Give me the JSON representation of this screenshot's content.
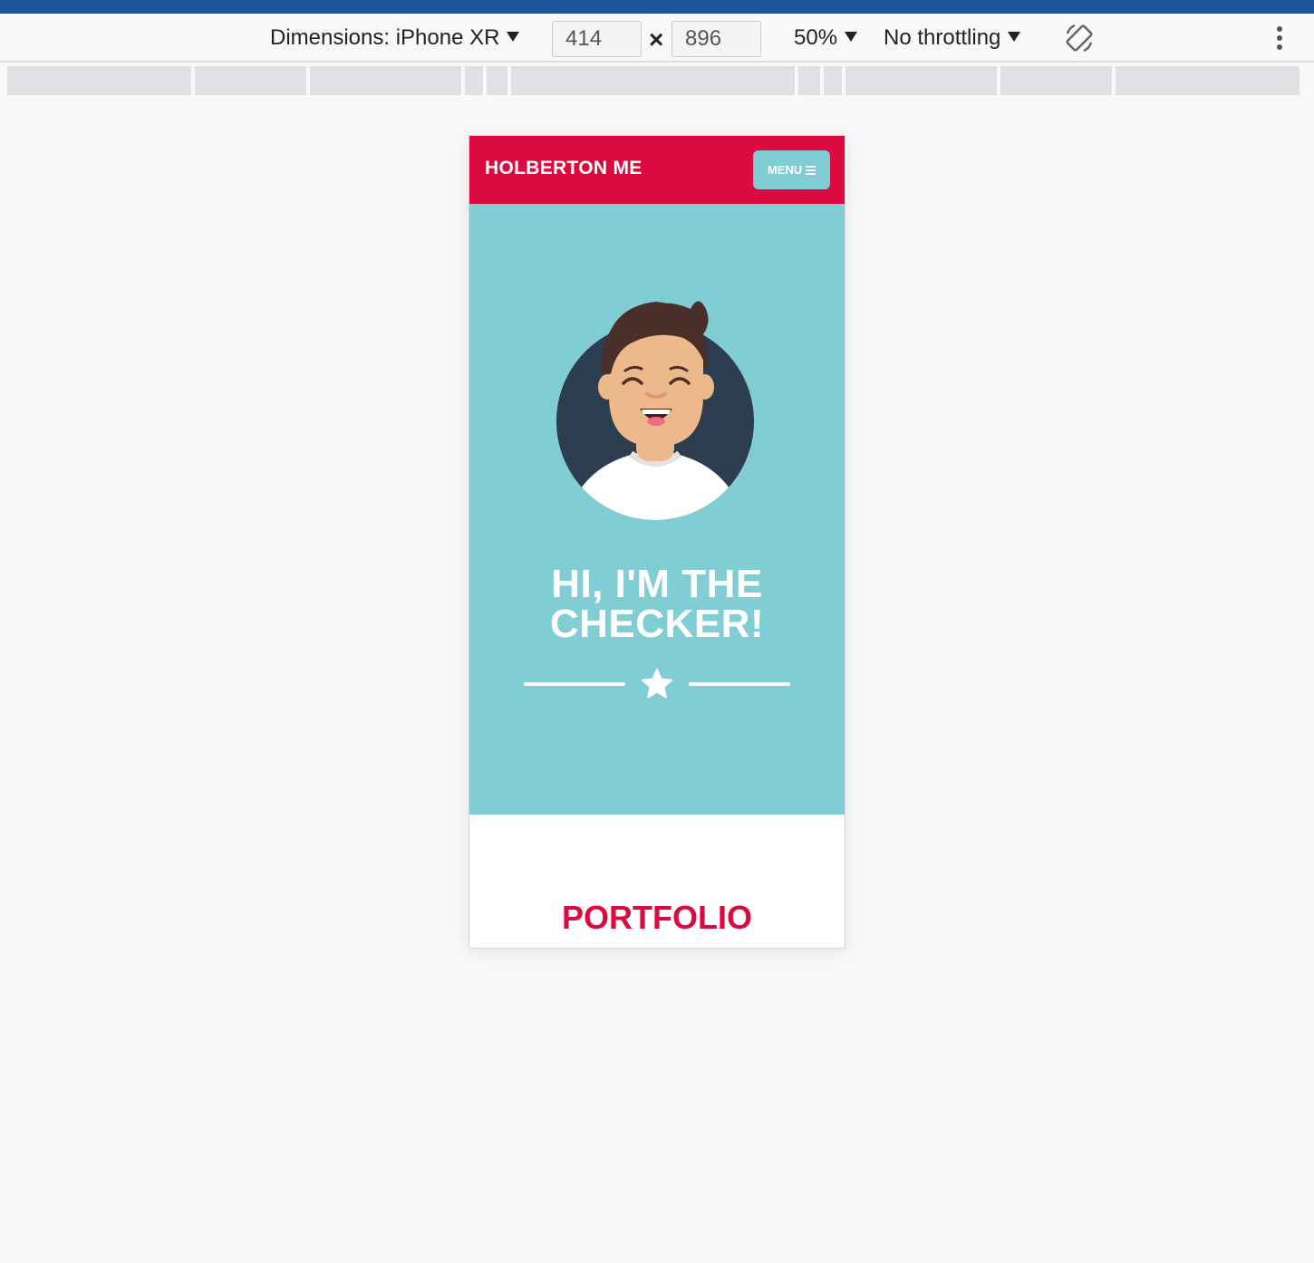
{
  "devtools": {
    "dimensions_label": "Dimensions: iPhone XR",
    "width_value": "414",
    "height_value": "896",
    "times_symbol": "×",
    "zoom": "50%",
    "throttling": "No throttling",
    "rotate_icon": "rotate-device-icon",
    "more_icon": "more-options-icon"
  },
  "page": {
    "brand": "HOLBERTON ME",
    "menu_label": "MENU",
    "menu_icon": "hamburger-icon",
    "hero_title_line1": "HI, I'M THE",
    "hero_title_line2": "CHECKER!",
    "divider_icon": "star-icon",
    "section_title": "PORTFOLIO"
  },
  "colors": {
    "chrome_blue": "#1b559c",
    "nav_red": "#dc0b3f",
    "hero_teal": "#80cdd3",
    "avatar_bg": "#2c3e50"
  }
}
